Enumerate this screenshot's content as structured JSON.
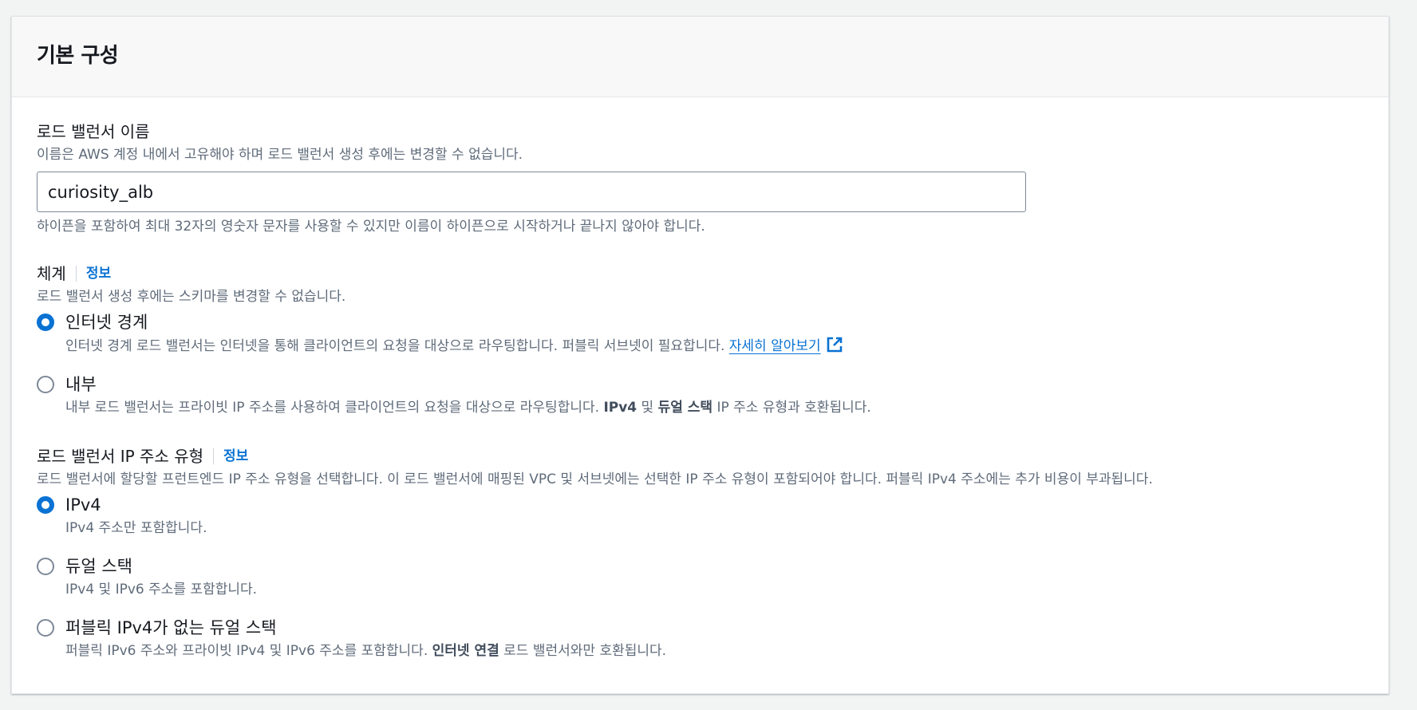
{
  "panel": {
    "title": "기본 구성"
  },
  "lb_name": {
    "label": "로드 밸런서 이름",
    "description": "이름은 AWS 계정 내에서 고유해야 하며 로드 밸런서 생성 후에는 변경할 수 없습니다.",
    "value": "curiosity_alb",
    "constraint": "하이픈을 포함하여 최대 32자의 영숫자 문자를 사용할 수 있지만 이름이 하이픈으로 시작하거나 끝나지 않아야 합니다."
  },
  "scheme": {
    "label": "체계",
    "info": "정보",
    "description": "로드 밸런서 생성 후에는 스키마를 변경할 수 없습니다.",
    "options": [
      {
        "label": "인터넷 경계",
        "checked": true,
        "desc": "인터넷 경계 로드 밸런서는 인터넷을 통해 클라이언트의 요청을 대상으로 라우팅합니다. 퍼블릭 서브넷이 필요합니다.",
        "link": "자세히 알아보기",
        "link_icon": "external-link-icon"
      },
      {
        "label": "내부",
        "checked": false,
        "desc_prefix": "내부 로드 밸런서는 프라이빗 IP 주소를 사용하여 클라이언트의 요청을 대상으로 라우팅합니다.",
        "desc_bold1": "IPv4",
        "desc_mid": "및",
        "desc_bold2": "듀얼 스택",
        "desc_suffix": "IP 주소 유형과 호환됩니다."
      }
    ]
  },
  "ip_type": {
    "label": "로드 밸런서 IP 주소 유형",
    "info": "정보",
    "description": "로드 밸런서에 할당할 프런트엔드 IP 주소 유형을 선택합니다. 이 로드 밸런서에 매핑된 VPC 및 서브넷에는 선택한 IP 주소 유형이 포함되어야 합니다. 퍼블릭 IPv4 주소에는 추가 비용이 부과됩니다.",
    "options": [
      {
        "label": "IPv4",
        "checked": true,
        "desc": "IPv4 주소만 포함합니다."
      },
      {
        "label": "듀얼 스택",
        "checked": false,
        "desc": "IPv4 및 IPv6 주소를 포함합니다."
      },
      {
        "label": "퍼블릭 IPv4가 없는 듀얼 스택",
        "checked": false,
        "desc_prefix": "퍼블릭 IPv6 주소와 프라이빗 IPv4 및 IPv6 주소를 포함합니다.",
        "desc_bold": "인터넷 연결",
        "desc_suffix": "로드 밸런서와만 호환됩니다."
      }
    ]
  },
  "colors": {
    "accent": "#0972d3",
    "text": "#16191f",
    "muted": "#5f6b7a"
  }
}
